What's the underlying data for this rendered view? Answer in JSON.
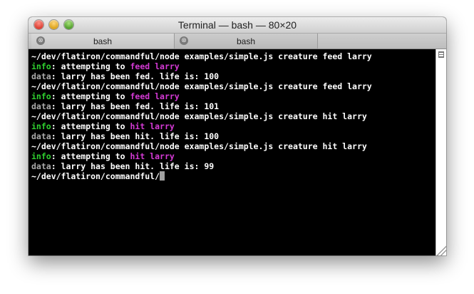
{
  "window": {
    "title": "Terminal — bash — 80×20",
    "buttons": [
      "close",
      "minimize",
      "zoom"
    ]
  },
  "tabs": [
    {
      "label": "bash",
      "close_icon": "⊗"
    },
    {
      "label": "bash",
      "close_icon": "⊗"
    }
  ],
  "terminal": {
    "lines": [
      {
        "type": "cmd",
        "text": "~/dev/flatiron/commandful/node examples/simple.js creature feed larry"
      },
      {
        "type": "info",
        "prefix": "info",
        "text": ": attempting to ",
        "hl": "feed larry"
      },
      {
        "type": "data",
        "prefix": "data",
        "text": ": larry has been fed. life is: 100"
      },
      {
        "type": "cmd",
        "text": "~/dev/flatiron/commandful/node examples/simple.js creature feed larry"
      },
      {
        "type": "info",
        "prefix": "info",
        "text": ": attempting to ",
        "hl": "feed larry"
      },
      {
        "type": "data",
        "prefix": "data",
        "text": ": larry has been fed. life is: 101"
      },
      {
        "type": "cmd",
        "text": "~/dev/flatiron/commandful/node examples/simple.js creature hit larry"
      },
      {
        "type": "info",
        "prefix": "info",
        "text": ": attempting to ",
        "hl": "hit larry"
      },
      {
        "type": "data",
        "prefix": "data",
        "text": ": larry has been hit. life is: 100"
      },
      {
        "type": "cmd",
        "text": "~/dev/flatiron/commandful/node examples/simple.js creature hit larry"
      },
      {
        "type": "info",
        "prefix": "info",
        "text": ": attempting to ",
        "hl": "hit larry"
      },
      {
        "type": "data",
        "prefix": "data",
        "text": ": larry has been hit. life is: 99"
      }
    ],
    "prompt": "~/dev/flatiron/commandful/"
  },
  "colors": {
    "info": "#2fd12f",
    "data": "#a9a9a9",
    "highlight": "#d63ad6",
    "background": "#000000",
    "foreground": "#ffffff"
  }
}
